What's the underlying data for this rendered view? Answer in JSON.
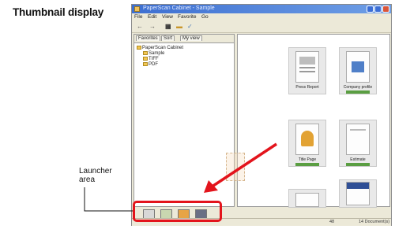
{
  "annotations": {
    "title": "Thumbnail display",
    "launcher_label": "Launcher\narea"
  },
  "window": {
    "title": "PaperScan Cabinet - Sample",
    "menu": [
      "File",
      "Edit",
      "View",
      "Favorite",
      "Go"
    ],
    "tabs": [
      "Favorites",
      "Sort",
      "My view"
    ],
    "tree": [
      "PaperScan Cabinet",
      "Sample",
      "TIFF",
      "PDF"
    ],
    "thumbnails": [
      {
        "caption": "Press Report"
      },
      {
        "caption": "Company profile"
      },
      {
        "caption": "Title Page"
      },
      {
        "caption": "Estimate"
      },
      {
        "caption": ""
      },
      {
        "caption": ""
      }
    ],
    "status": {
      "left": "48",
      "right": "14 Document(s)"
    }
  },
  "colors": {
    "highlight": "#e3141c",
    "titlebar": "#3d6fd1",
    "progress": "#5a9e42"
  },
  "icons": [
    "cabinet-icon",
    "scanner-icon",
    "folder-icon",
    "printer-icon"
  ]
}
